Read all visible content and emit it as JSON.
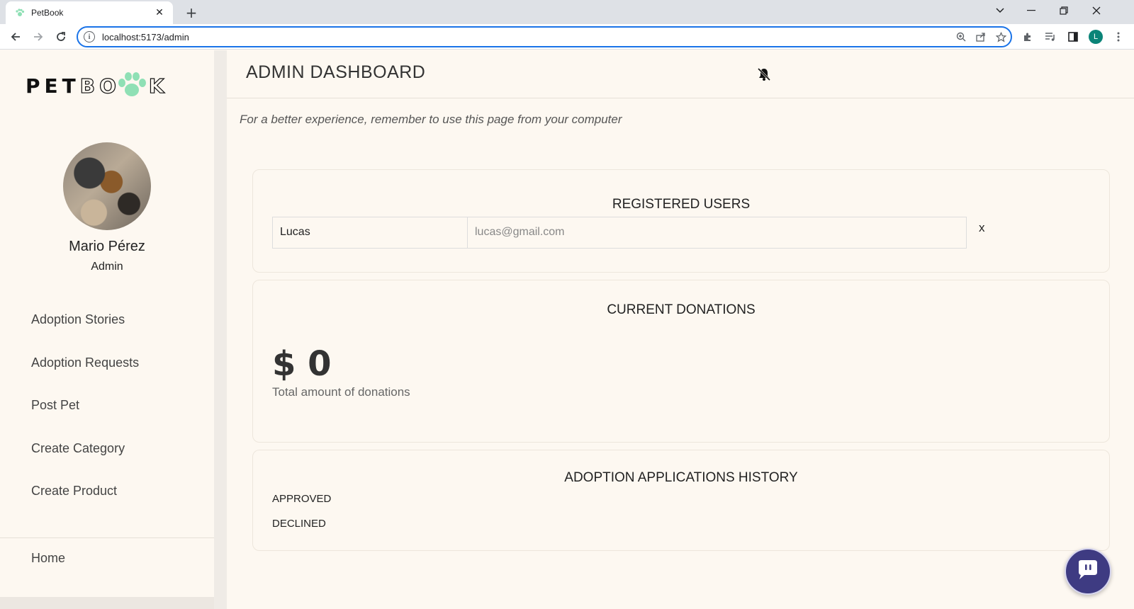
{
  "browser": {
    "tab_title": "PetBook",
    "url": "localhost:5173/admin",
    "profile_initial": "L"
  },
  "sidebar": {
    "logo_parts": {
      "solid": "PET",
      "outline_a": "BO",
      "outline_b": "K"
    },
    "user_name": "Mario Pérez",
    "user_role": "Admin",
    "items": [
      {
        "label": "Adoption Stories"
      },
      {
        "label": "Adoption Requests"
      },
      {
        "label": "Post Pet"
      },
      {
        "label": "Create Category"
      },
      {
        "label": "Create Product"
      }
    ],
    "home_label": "Home"
  },
  "main": {
    "title": "ADMIN DASHBOARD",
    "hint": "For a better experience, remember to use this page from your computer",
    "registered_users": {
      "title": "REGISTERED USERS",
      "users": [
        {
          "name": "Lucas",
          "email": "lucas@gmail.com",
          "delete_label": "x"
        }
      ]
    },
    "donations": {
      "title": "CURRENT DONATIONS",
      "amount": "$ 0",
      "label": "Total amount of donations"
    },
    "history": {
      "title": "ADOPTION APPLICATIONS HISTORY",
      "items": [
        "APPROVED",
        "DECLINED"
      ]
    }
  },
  "colors": {
    "page_bg": "#fdf8f1",
    "accent_blue": "#1a73e8",
    "paw_green": "#8fe0b5",
    "chat_button": "#3e3b82",
    "profile": "#0b8478"
  },
  "icons": [
    "paw-icon",
    "back-icon",
    "forward-icon",
    "reload-icon",
    "info-icon",
    "zoom-icon",
    "share-icon",
    "star-icon",
    "extensions-icon",
    "media-icon",
    "sidepanel-icon",
    "menu-icon",
    "bell-off-icon",
    "chat-icon"
  ]
}
